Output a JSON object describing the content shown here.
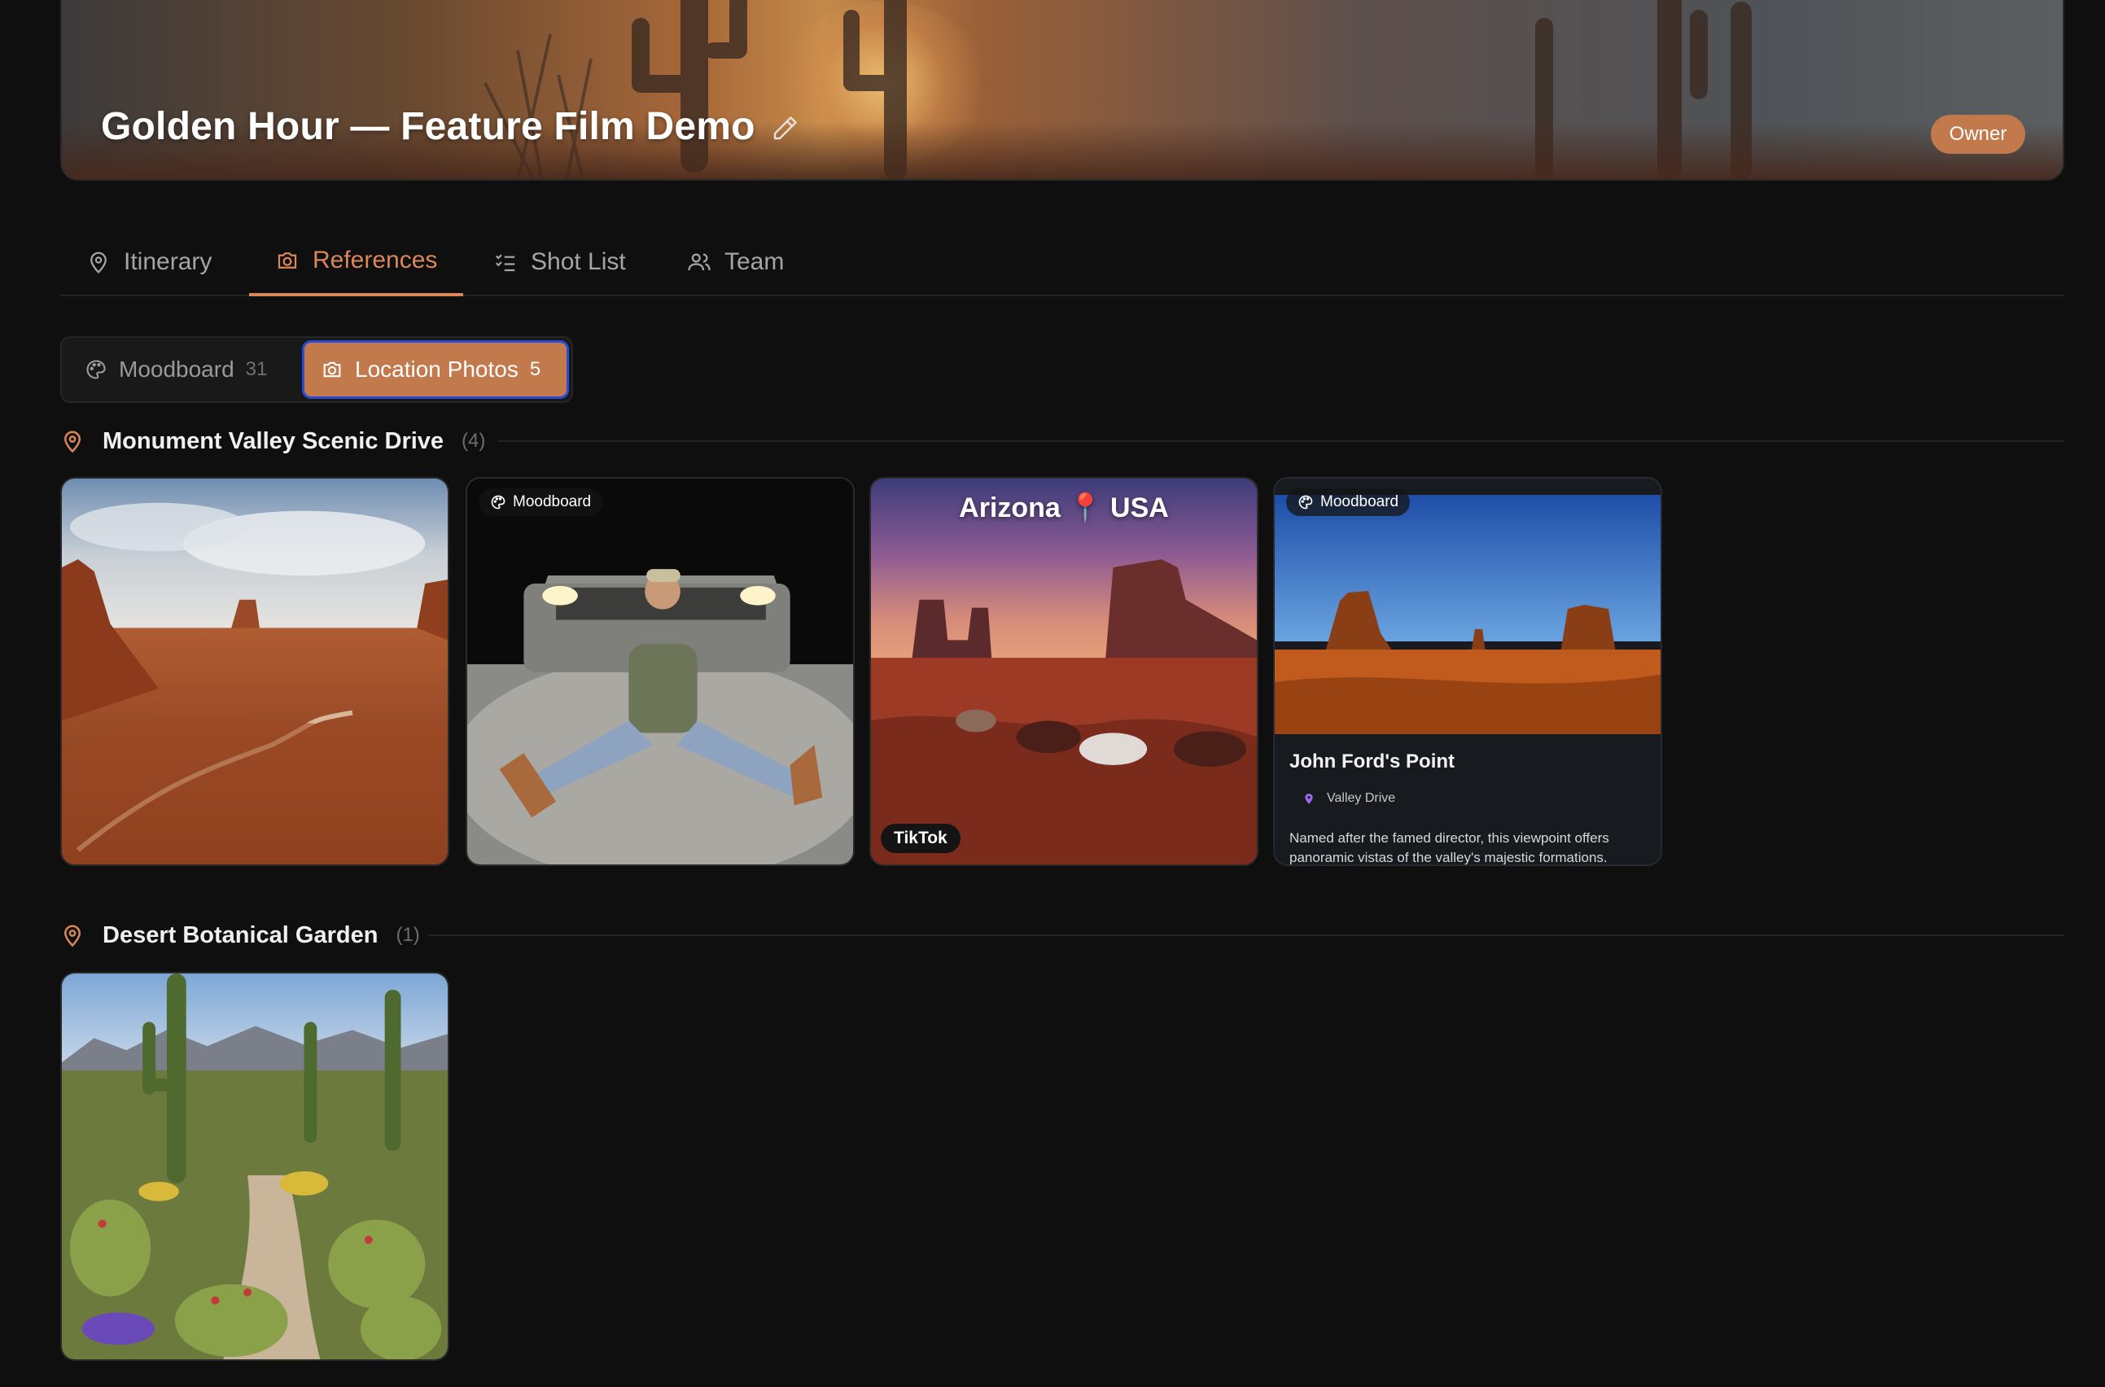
{
  "project": {
    "title": "Golden Hour — Feature Film Demo",
    "role_badge": "Owner"
  },
  "tabs": [
    {
      "label": "Itinerary",
      "icon": "map-pin-icon",
      "active": false
    },
    {
      "label": "References",
      "icon": "camera-icon",
      "active": true
    },
    {
      "label": "Shot List",
      "icon": "checklist-icon",
      "active": false
    },
    {
      "label": "Team",
      "icon": "users-icon",
      "active": false
    }
  ],
  "reference_filter": {
    "moodboard": {
      "label": "Moodboard",
      "count": "31",
      "icon": "palette-icon"
    },
    "location_photos": {
      "label": "Location Photos",
      "count": "5",
      "icon": "camera-icon",
      "active": true
    }
  },
  "sections": [
    {
      "title": "Monument Valley Scenic Drive",
      "count": "(4)",
      "items": [
        {
          "type": "photo",
          "subject": "desert valley with winding road"
        },
        {
          "type": "photo",
          "chip": "Moodboard",
          "subject": "man sitting in front of car headlights"
        },
        {
          "type": "photo",
          "overlay_text": "Arizona 📍 USA",
          "source_badge": "TikTok",
          "subject": "horses grazing at sunset in Monument Valley"
        },
        {
          "type": "place",
          "chip": "Moodboard",
          "name": "John Ford's Point",
          "location": "Valley Drive",
          "description": "Named after the famed director, this viewpoint offers panoramic vistas of the valley's majestic formations."
        }
      ]
    },
    {
      "title": "Desert Botanical Garden",
      "count": "(1)",
      "items": [
        {
          "type": "photo",
          "subject": "cactus garden path with mountains"
        }
      ]
    }
  ],
  "colors": {
    "background": "#0f0f10",
    "accent": "#c27a4d",
    "active_tab": "#d9875a",
    "focus_ring": "#2a4bd6"
  }
}
